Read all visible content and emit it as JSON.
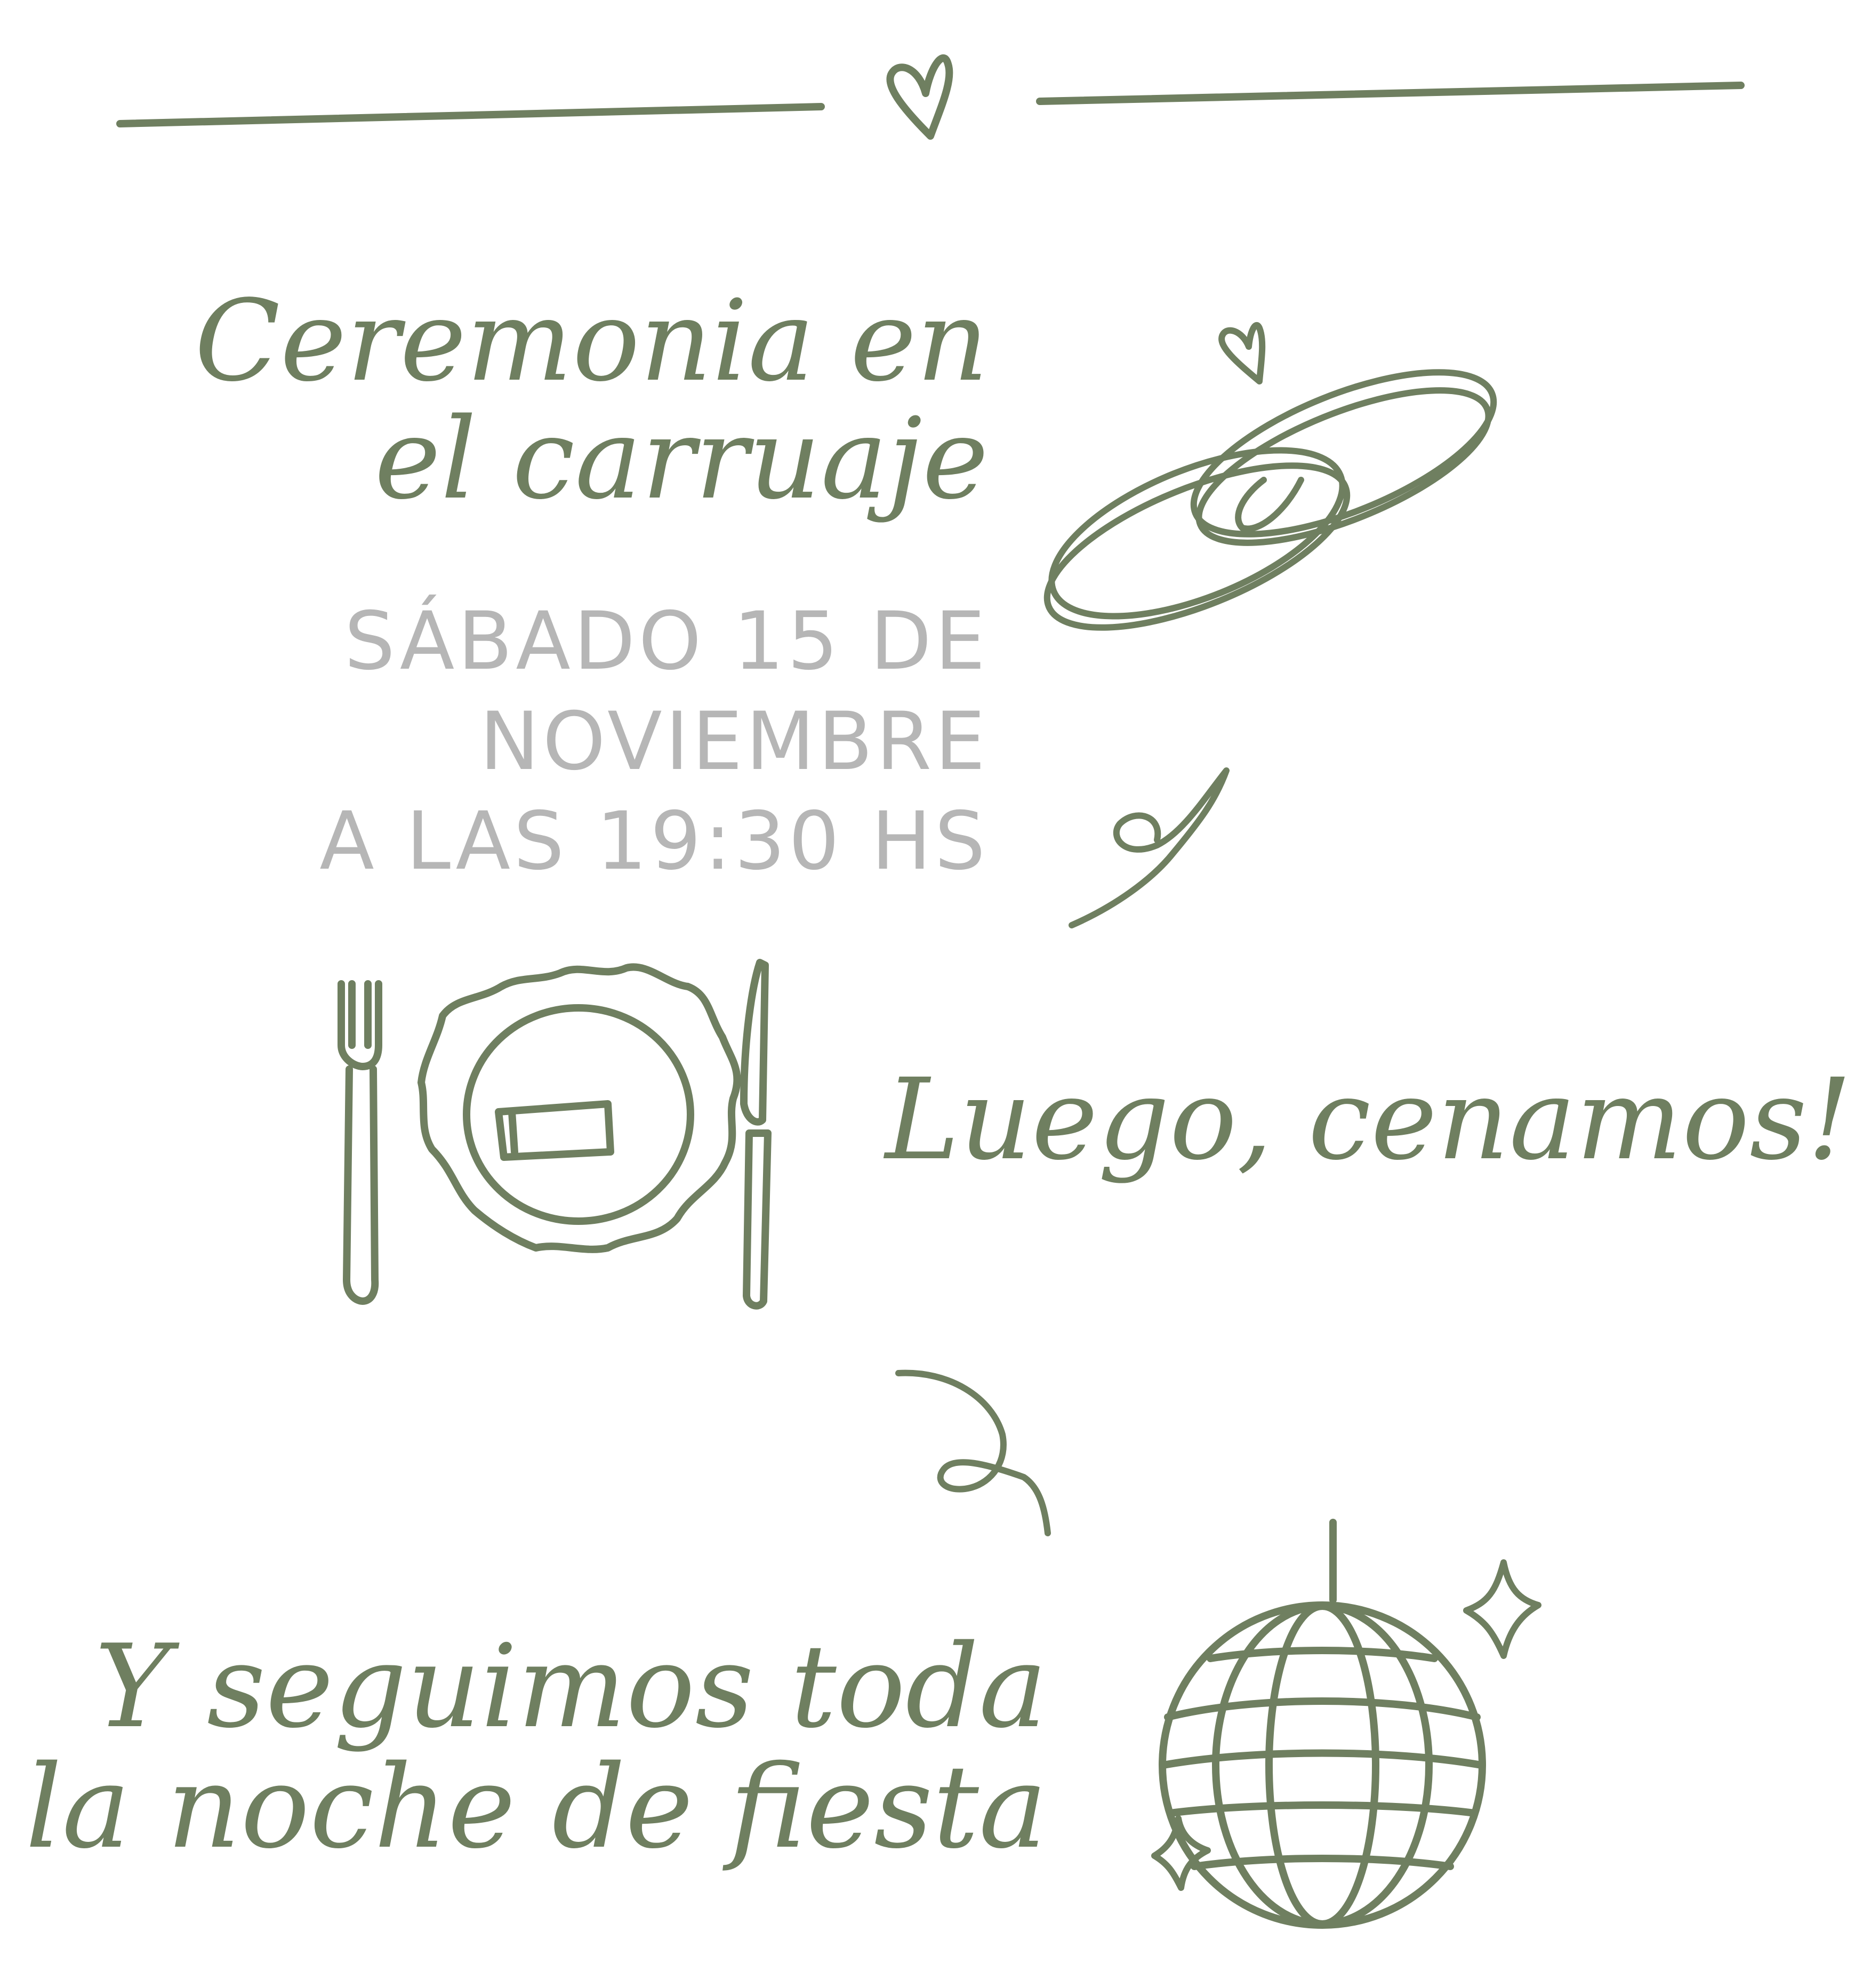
{
  "colors": {
    "ink_green": "#6f7f60",
    "ink_gray": "#b6b6b6",
    "background": "#ffffff"
  },
  "ceremony": {
    "title_line1": "Ceremonia en",
    "title_line2": "el carruaje",
    "date_line1": "SÁBADO 15 DE NOVIEMBRE",
    "date_line2": "A LAS 19:30 HS"
  },
  "dinner": {
    "title": "Luego, cenamos!"
  },
  "party": {
    "title_line1": "Y seguimos toda",
    "title_line2": "la noche de fiesta"
  },
  "icons": [
    "heart-icon",
    "wedding-rings-icon",
    "swirl-icon",
    "place-setting-icon",
    "disco-ball-icon",
    "sparkle-icon"
  ]
}
